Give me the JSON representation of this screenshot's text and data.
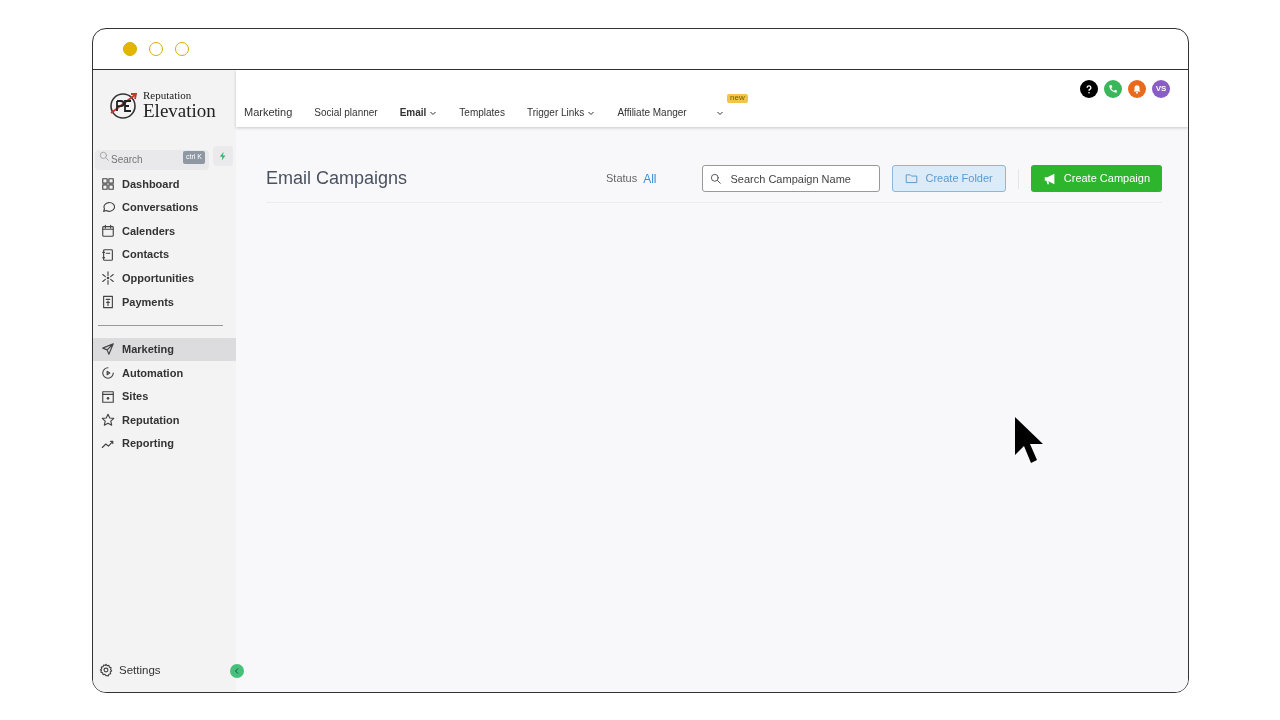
{
  "window": {
    "controls": [
      {
        "filled": true
      },
      {
        "filled": false
      },
      {
        "filled": false
      }
    ]
  },
  "brand": {
    "small": "Reputation",
    "large": "Elevation"
  },
  "sidebar": {
    "search": {
      "placeholder": "Search",
      "shortcut": "ctrl K"
    },
    "groups": [
      [
        {
          "label": "Dashboard",
          "selected": false
        },
        {
          "label": "Conversations",
          "selected": false
        },
        {
          "label": "Calenders",
          "selected": false
        },
        {
          "label": "Contacts",
          "selected": false
        },
        {
          "label": "Opportunities",
          "selected": false
        },
        {
          "label": "Payments",
          "selected": false
        }
      ],
      [
        {
          "label": "Marketing",
          "selected": true
        },
        {
          "label": "Automation",
          "selected": false
        },
        {
          "label": "Sites",
          "selected": false
        },
        {
          "label": "Reputation",
          "selected": false
        },
        {
          "label": "Reporting",
          "selected": false
        }
      ]
    ],
    "settings": "Settings"
  },
  "topnav": {
    "items": [
      {
        "label": "Marketing",
        "selected": false,
        "dropdown": false
      },
      {
        "label": "Social planner",
        "selected": false,
        "dropdown": false
      },
      {
        "label": "Email",
        "selected": true,
        "dropdown": true
      },
      {
        "label": "Templates",
        "selected": false,
        "dropdown": false
      },
      {
        "label": "Trigger Links",
        "selected": false,
        "dropdown": true
      },
      {
        "label": "Affiliate Manger",
        "selected": false,
        "dropdown": true,
        "badge": "new"
      }
    ],
    "avatar": "VS"
  },
  "page": {
    "title": "Email Campaigns",
    "status_label": "Status",
    "status_value": "All",
    "search": {
      "placeholder": "Search Campaign Name"
    },
    "buttons": [
      "Create Folder",
      "Create Campaign"
    ]
  }
}
